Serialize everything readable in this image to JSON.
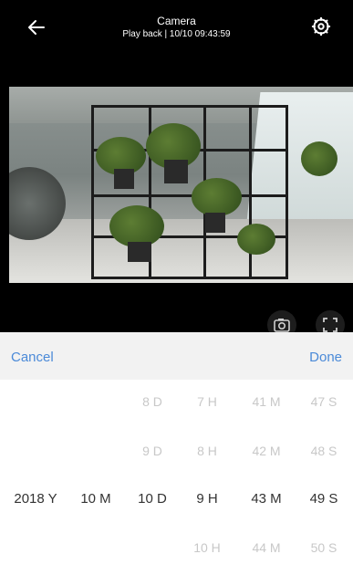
{
  "header": {
    "title": "Camera",
    "subtitle": "Play back | 10/10 09:43:59",
    "back_icon": "back-arrow-icon",
    "settings_icon": "gear-icon"
  },
  "video": {
    "description": "",
    "snapshot_icon": "camera-icon",
    "fullscreen_icon": "fullscreen-icon"
  },
  "action_bar": {
    "cancel_label": "Cancel",
    "done_label": "Done",
    "accent_color": "#4b8ad8"
  },
  "picker": {
    "rows": [
      [
        "",
        "",
        "8 D",
        "7 H",
        "41 M",
        "47 S"
      ],
      [
        "",
        "",
        "9 D",
        "8 H",
        "42 M",
        "48 S"
      ],
      [
        "2018 Y",
        "10 M",
        "10 D",
        "9 H",
        "43 M",
        "49 S"
      ],
      [
        "",
        "",
        "",
        "10 H",
        "44 M",
        "50 S"
      ]
    ],
    "selected_row_index": 2
  }
}
